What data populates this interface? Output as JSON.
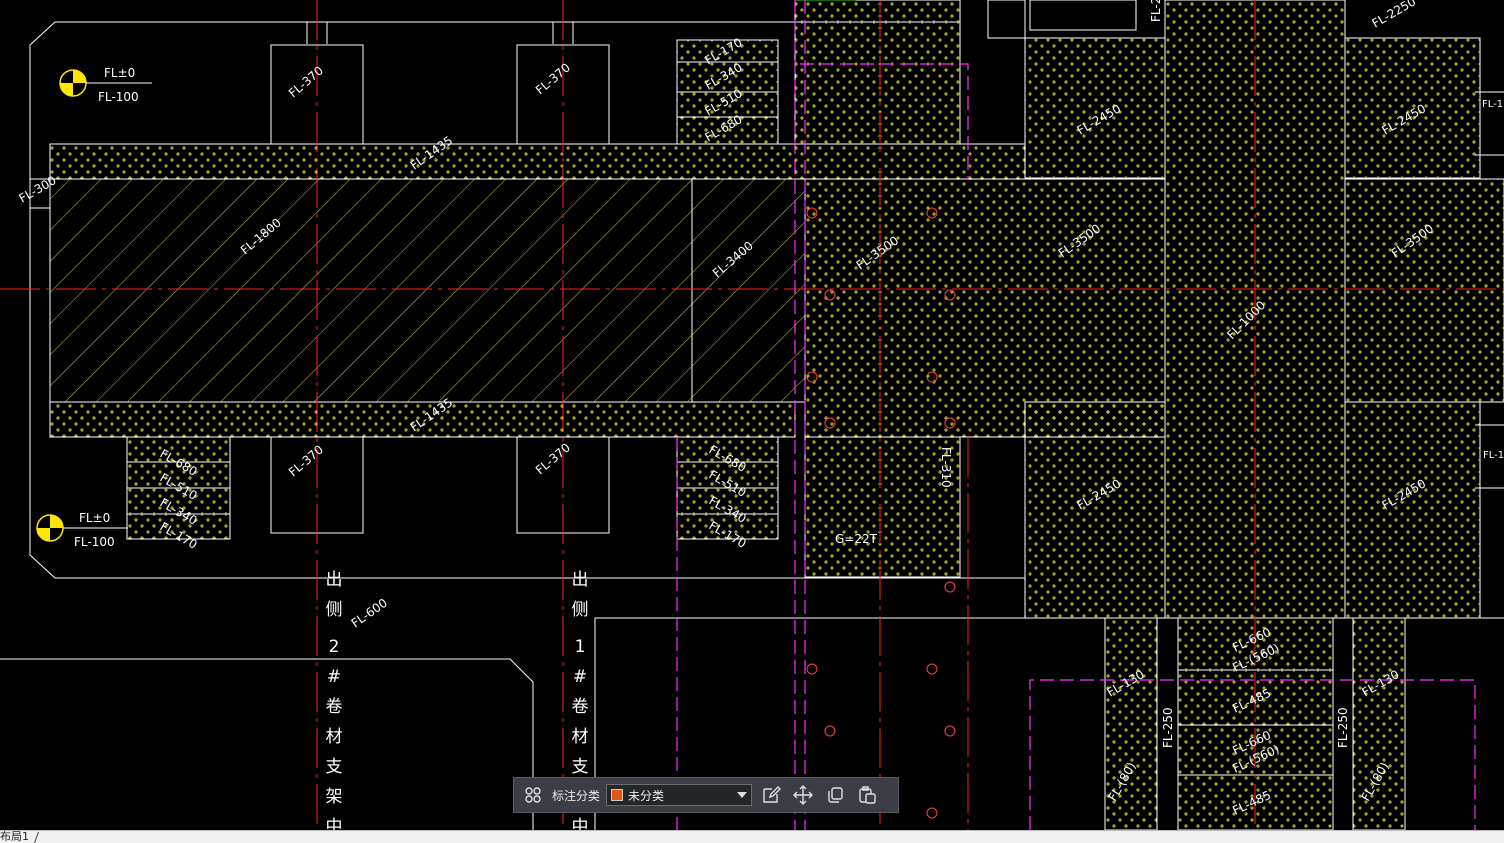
{
  "colors": {
    "background": "#000000",
    "outline": "#ffffff",
    "axis": "#ff2020",
    "fill_pattern": "#ffff40",
    "guide": "#ff30ff",
    "marker": "#ffe600",
    "swatch": "#e05a10"
  },
  "drawing": {
    "level_markers": [
      {
        "top": "FL±0",
        "bottom": "FL-100"
      },
      {
        "top": "FL±0",
        "bottom": "FL-100"
      }
    ],
    "labels": {
      "l1": "FL-370",
      "l2": "FL-370",
      "l3": "FL-370",
      "l4": "FL-370",
      "l5": "FL-1435",
      "l6": "FL-1435",
      "l7": "FL-1800",
      "l8": "FL-3400",
      "l9": "FL-300",
      "l10": "FL-600",
      "l11": "FL-170",
      "l12": "FL-340",
      "l13": "FL-510",
      "l14": "FL-680",
      "l15": "FL-680",
      "l16": "FL-510",
      "l17": "FL-340",
      "l18": "FL-170",
      "l19": "FL-680",
      "l20": "FL-510",
      "l21": "FL-340",
      "l22": "FL-170",
      "l23": "FL-680",
      "l24": "FL-510",
      "l25": "FL-340",
      "l26": "FL-170",
      "l27": "FL-3500",
      "l28": "FL-3500",
      "l29": "FL-3500",
      "l30": "FL-2450",
      "l31": "FL-2450",
      "l32": "FL-2450",
      "l33": "FL-2450",
      "l34": "FL-2250",
      "l35": "FL-1000",
      "l36": "FL-310",
      "l37": "G=22T",
      "l38": "FL-660",
      "l39": "FL-(560)",
      "l40": "FL-485",
      "l41": "FL-660",
      "l42": "FL-(560)",
      "l43": "FL-485",
      "l44": "FL-130",
      "l45": "FL-130",
      "l46": "FL-250",
      "l47": "FL-250",
      "l48": "FL-(80)",
      "l49": "FL-(80)",
      "l50": "FL-1",
      "l51": "FL-1",
      "l52": "FL-2"
    },
    "vertical_notes": {
      "left": [
        "出",
        "侧",
        "2",
        "#",
        "卷",
        "材",
        "支",
        "架",
        "中"
      ],
      "right": [
        "出",
        "侧",
        "1",
        "#",
        "卷",
        "材",
        "支",
        "架",
        "中"
      ]
    }
  },
  "toolbar": {
    "category_label": "标注分类",
    "selected_category": "未分类",
    "buttons": [
      "grid-icon",
      "edit-icon",
      "move-icon",
      "copy-icon",
      "paste-icon"
    ]
  },
  "layout_tab": {
    "label": "布局1"
  }
}
